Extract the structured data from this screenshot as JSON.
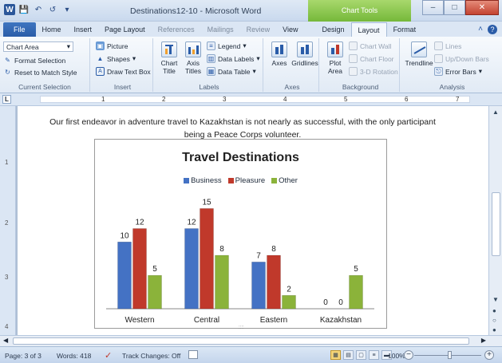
{
  "window": {
    "title": "Destinations12-10 - Microsoft Word",
    "contextual_tab_group": "Chart Tools",
    "minimize_icon": "minimize-icon",
    "maximize_icon": "maximize-icon",
    "close_icon": "close-icon"
  },
  "tabs": [
    {
      "label": "File"
    },
    {
      "label": "Home"
    },
    {
      "label": "Insert"
    },
    {
      "label": "Page Layout"
    },
    {
      "label": "References"
    },
    {
      "label": "Mailings"
    },
    {
      "label": "Review"
    },
    {
      "label": "View"
    },
    {
      "label": "Design"
    },
    {
      "label": "Layout"
    },
    {
      "label": "Format"
    }
  ],
  "ribbon": {
    "current_selection": {
      "label": "Current Selection",
      "dropdown_value": "Chart Area",
      "format_selection": "Format Selection",
      "reset": "Reset to Match Style"
    },
    "insert": {
      "label": "Insert",
      "picture": "Picture",
      "shapes": "Shapes",
      "text_box": "Draw Text Box"
    },
    "labels": {
      "label": "Labels",
      "chart_title": "Chart Title",
      "axis_titles": "Axis Titles",
      "legend": "Legend",
      "data_labels": "Data Labels",
      "data_table": "Data Table"
    },
    "axes": {
      "label": "Axes",
      "axes": "Axes",
      "gridlines": "Gridlines"
    },
    "background": {
      "label": "Background",
      "plot_area": "Plot Area",
      "chart_wall": "Chart Wall",
      "chart_floor": "Chart Floor",
      "rotation": "3-D Rotation"
    },
    "analysis": {
      "label": "Analysis",
      "trendline": "Trendline",
      "lines": "Lines",
      "updown": "Up/Down Bars",
      "error_bars": "Error Bars"
    }
  },
  "ruler_numbers": [
    "1",
    "2",
    "3",
    "4",
    "5",
    "6",
    "7"
  ],
  "vruler_numbers": [
    "1",
    "2",
    "3",
    "4"
  ],
  "document": {
    "paragraph": "Our first endeavor in adventure travel to Kazakhstan is not nearly as successful, with the only participant being a Peace Corps volunteer."
  },
  "chart_data": {
    "type": "bar",
    "title": "Travel Destinations",
    "categories": [
      "Western",
      "Central",
      "Eastern",
      "Kazakhstan"
    ],
    "series": [
      {
        "name": "Business",
        "values": [
          10,
          12,
          7,
          0
        ],
        "color": "#4472c4"
      },
      {
        "name": "Pleasure",
        "values": [
          12,
          15,
          8,
          0
        ],
        "color": "#c0392b"
      },
      {
        "name": "Other",
        "values": [
          5,
          8,
          2,
          5
        ],
        "color": "#8bb33a"
      }
    ],
    "ylim": [
      0,
      16
    ],
    "legend_position": "top",
    "grid": false
  },
  "status": {
    "page": "Page: 3 of 3",
    "words": "Words: 418",
    "track_changes": "Track Changes: Off",
    "zoom": "100%"
  }
}
